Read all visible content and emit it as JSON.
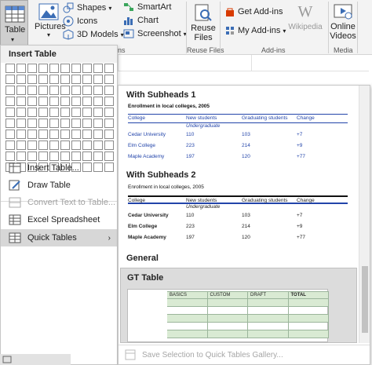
{
  "ribbon": {
    "table_label": "Table",
    "pictures_label": "Pictures",
    "shapes_label": "Shapes",
    "icons_label": "Icons",
    "models_label": "3D Models",
    "smartart_label": "SmartArt",
    "chart_label": "Chart",
    "screenshot_label": "Screenshot",
    "reuse_files_label": "Reuse Files",
    "reuse_files_group": "Reuse Files",
    "get_addins_label": "Get Add-ins",
    "my_addins_label": "My Add-ins",
    "wikipedia_label": "Wikipedia",
    "addins_group": "Add-ins",
    "online_videos_label": "Online Videos",
    "media_group": "Media",
    "partial_group": "ns"
  },
  "menu": {
    "header": "Insert Table",
    "items": [
      {
        "label": "Insert Table...",
        "icon": "insert-table-icon"
      },
      {
        "label": "Draw Table",
        "icon": "pencil-icon"
      },
      {
        "label": "Convert Text to Table...",
        "icon": "convert-table-icon",
        "disabled": true
      },
      {
        "label": "Excel Spreadsheet",
        "icon": "excel-icon"
      },
      {
        "label": "Quick Tables",
        "icon": "quick-tables-icon",
        "active": true
      }
    ]
  },
  "gallery": {
    "sub1": {
      "title": "With Subheads 1",
      "caption": "Enrollment in local colleges, 2005",
      "headers": [
        "College",
        "New students",
        "Graduating students",
        "Change"
      ],
      "subhead": "Undergraduate",
      "rows": [
        [
          "Cedar University",
          "110",
          "103",
          "+7"
        ],
        [
          "Elm College",
          "223",
          "214",
          "+9"
        ],
        [
          "Maple Academy",
          "197",
          "120",
          "+77"
        ]
      ]
    },
    "sub2": {
      "title": "With Subheads 2",
      "caption": "Enrollment in local colleges, 2005",
      "headers": [
        "College",
        "New students",
        "Graduating students",
        "Change"
      ],
      "subhead": "Undergraduate",
      "rows": [
        [
          "Cedar University",
          "110",
          "103",
          "+7"
        ],
        [
          "Elm College",
          "223",
          "214",
          "+9"
        ],
        [
          "Maple Academy",
          "197",
          "120",
          "+77"
        ]
      ]
    },
    "general_label": "General",
    "gt": {
      "title": "GT Table",
      "headers": [
        "BASICS",
        "CUSTOM",
        "DRAFT",
        "TOTAL"
      ]
    },
    "footer": "Save Selection to Quick Tables Gallery..."
  }
}
